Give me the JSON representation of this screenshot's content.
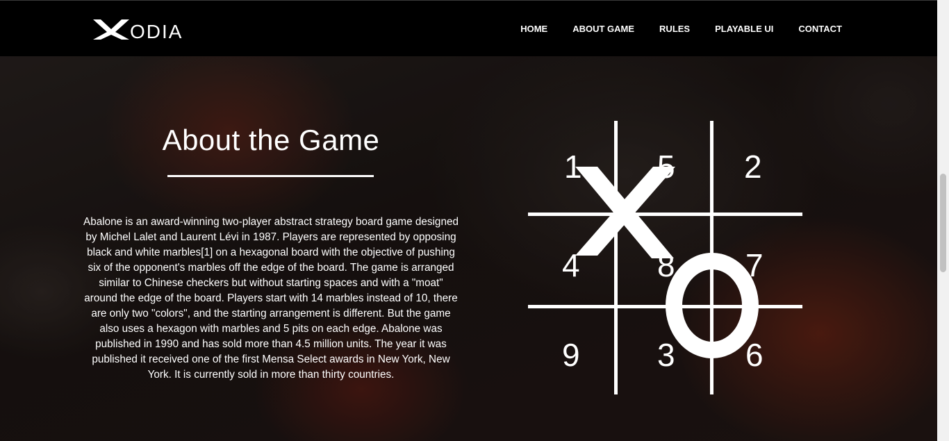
{
  "brand": {
    "logo_text": "ODIA"
  },
  "nav": {
    "items": [
      {
        "label": "HOME"
      },
      {
        "label": "ABOUT GAME"
      },
      {
        "label": "RULES"
      },
      {
        "label": "PLAYABLE UI"
      },
      {
        "label": "CONTACT"
      }
    ]
  },
  "about": {
    "title": "About the Game",
    "body": "Abalone is an award-winning two-player abstract strategy board game designed by Michel Lalet and Laurent Lévi in 1987. Players are represented by opposing black and white marbles[1] on a hexagonal board with the objective of pushing six of the opponent's marbles off the edge of the board. The game is arranged similar to Chinese checkers but without starting spaces and with a \"moat\" around the edge of the board. Players start with 14 marbles instead of 10, there are only two \"colors\", and the starting arrangement is different. But the game also uses a hexagon with marbles and 5 pits on each edge. Abalone was published in 1990 and has sold more than 4.5 million units. The year it was published it received one of the first Mensa Select awards in New York, New York. It is currently sold in more than thirty countries."
  },
  "graphic": {
    "cell_numbers": [
      "1",
      "5",
      "2",
      "4",
      "8",
      "7",
      "9",
      "3",
      "6"
    ],
    "x_mark": "X",
    "o_mark": "O"
  },
  "colors": {
    "header_bg": "#000000",
    "text": "#ffffff",
    "scrollbar_track": "#f1f1f1",
    "scrollbar_thumb": "#c1c1c1"
  }
}
